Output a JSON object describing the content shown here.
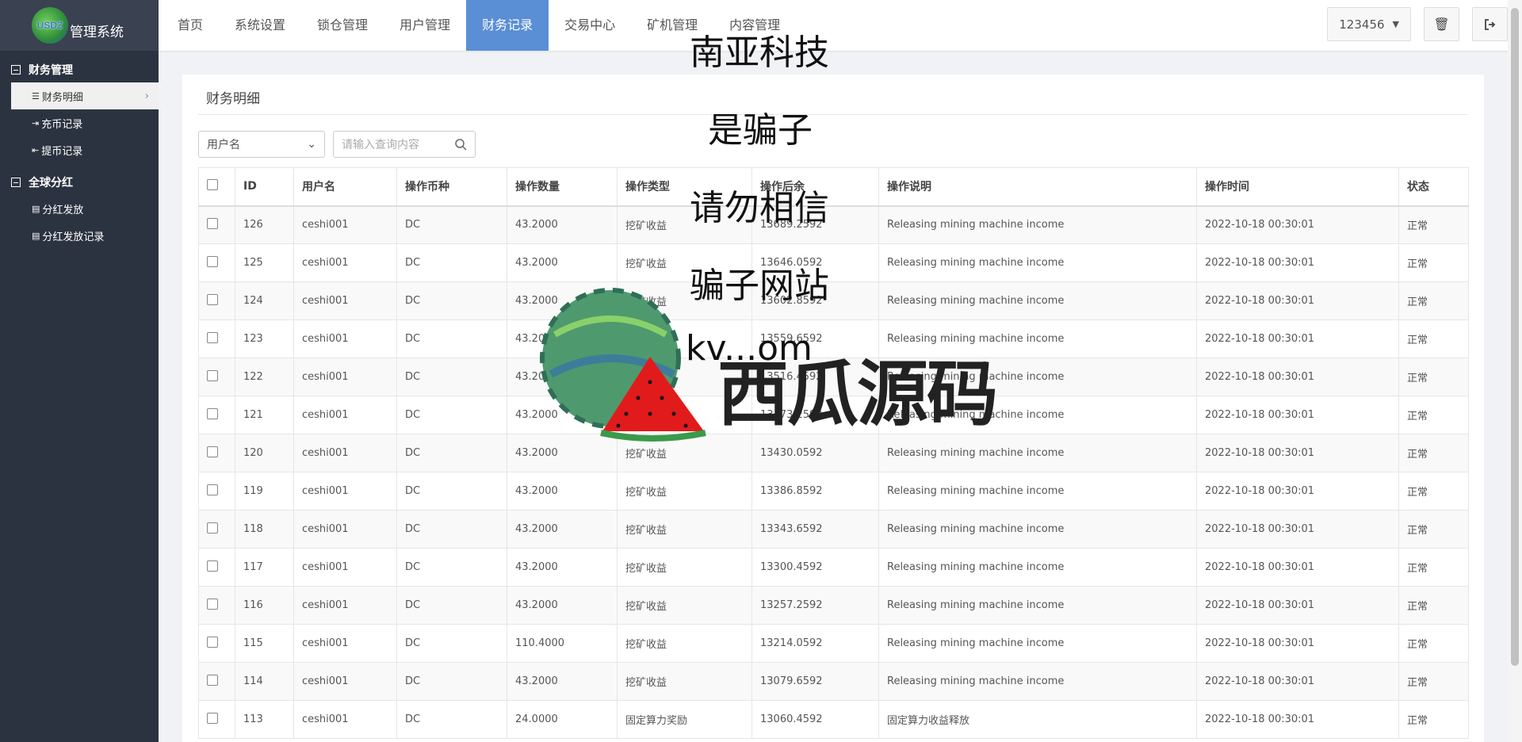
{
  "sidebar": {
    "logo_text": "管理系统",
    "logo_mark": "USDZ",
    "groups": [
      {
        "label": "财务管理",
        "items": [
          {
            "label": "财务明细",
            "icon": "list-icon",
            "active": true
          },
          {
            "label": "充币记录",
            "icon": "sign-in-icon"
          },
          {
            "label": "提币记录",
            "icon": "sign-out-icon"
          }
        ]
      },
      {
        "label": "全球分红",
        "items": [
          {
            "label": "分红发放",
            "icon": "doc-icon"
          },
          {
            "label": "分红发放记录",
            "icon": "doc-icon"
          }
        ]
      }
    ]
  },
  "nav": {
    "tabs": [
      "首页",
      "系统设置",
      "锁仓管理",
      "用户管理",
      "财务记录",
      "交易中心",
      "矿机管理",
      "内容管理"
    ],
    "active_index": 4,
    "user": "123456",
    "accent": "#5a8fd6"
  },
  "panel": {
    "title": "财务明细",
    "filter_select": "用户名",
    "search_placeholder": "请输入查询内容"
  },
  "table": {
    "columns": [
      "ID",
      "用户名",
      "操作币种",
      "操作数量",
      "操作类型",
      "操作后余",
      "操作说明",
      "操作时间",
      "状态"
    ],
    "rows": [
      [
        "126",
        "ceshi001",
        "DC",
        "43.2000",
        "挖矿收益",
        "13689.2592",
        "Releasing mining machine income",
        "2022-10-18 00:30:01",
        "正常"
      ],
      [
        "125",
        "ceshi001",
        "DC",
        "43.2000",
        "挖矿收益",
        "13646.0592",
        "Releasing mining machine income",
        "2022-10-18 00:30:01",
        "正常"
      ],
      [
        "124",
        "ceshi001",
        "DC",
        "43.2000",
        "挖矿收益",
        "13602.8592",
        "Releasing mining machine income",
        "2022-10-18 00:30:01",
        "正常"
      ],
      [
        "123",
        "ceshi001",
        "DC",
        "43.2000",
        "挖矿收益",
        "13559.6592",
        "Releasing mining machine income",
        "2022-10-18 00:30:01",
        "正常"
      ],
      [
        "122",
        "ceshi001",
        "DC",
        "43.2000",
        "挖矿收益",
        "13516.4592",
        "Releasing mining machine income",
        "2022-10-18 00:30:01",
        "正常"
      ],
      [
        "121",
        "ceshi001",
        "DC",
        "43.2000",
        "挖矿收益",
        "13473.2592",
        "Releasing mining machine income",
        "2022-10-18 00:30:01",
        "正常"
      ],
      [
        "120",
        "ceshi001",
        "DC",
        "43.2000",
        "挖矿收益",
        "13430.0592",
        "Releasing mining machine income",
        "2022-10-18 00:30:01",
        "正常"
      ],
      [
        "119",
        "ceshi001",
        "DC",
        "43.2000",
        "挖矿收益",
        "13386.8592",
        "Releasing mining machine income",
        "2022-10-18 00:30:01",
        "正常"
      ],
      [
        "118",
        "ceshi001",
        "DC",
        "43.2000",
        "挖矿收益",
        "13343.6592",
        "Releasing mining machine income",
        "2022-10-18 00:30:01",
        "正常"
      ],
      [
        "117",
        "ceshi001",
        "DC",
        "43.2000",
        "挖矿收益",
        "13300.4592",
        "Releasing mining machine income",
        "2022-10-18 00:30:01",
        "正常"
      ],
      [
        "116",
        "ceshi001",
        "DC",
        "43.2000",
        "挖矿收益",
        "13257.2592",
        "Releasing mining machine income",
        "2022-10-18 00:30:01",
        "正常"
      ],
      [
        "115",
        "ceshi001",
        "DC",
        "110.4000",
        "挖矿收益",
        "13214.0592",
        "Releasing mining machine income",
        "2022-10-18 00:30:01",
        "正常"
      ],
      [
        "114",
        "ceshi001",
        "DC",
        "43.2000",
        "挖矿收益",
        "13079.6592",
        "Releasing mining machine income",
        "2022-10-18 00:30:01",
        "正常"
      ],
      [
        "113",
        "ceshi001",
        "DC",
        "24.0000",
        "固定算力奖励",
        "13060.4592",
        "固定算力收益释放",
        "2022-10-18 00:30:01",
        "正常"
      ]
    ]
  },
  "overlay": {
    "lines": [
      "南亚科技",
      "是骗子",
      "请勿相信",
      "骗子网站",
      "kv...om"
    ],
    "watermark": "西瓜源码"
  }
}
